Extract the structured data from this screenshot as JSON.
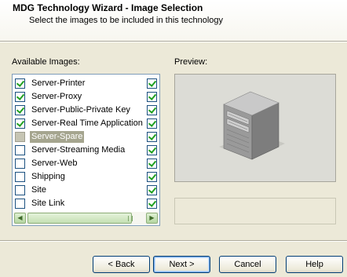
{
  "header": {
    "title": "MDG Technology Wizard - Image Selection",
    "subtitle": "Select the images to be included in this technology"
  },
  "available": {
    "label": "Available Images:",
    "items": [
      {
        "label": "Server-Printer",
        "left_checked": true,
        "right_checked": true
      },
      {
        "label": "Server-Proxy",
        "left_checked": true,
        "right_checked": true
      },
      {
        "label": "Server-Public-Private Key",
        "left_checked": true,
        "right_checked": true
      },
      {
        "label": "Server-Real Time Application",
        "left_checked": true,
        "right_checked": true
      },
      {
        "label": "Server-Spare",
        "left_checked": false,
        "right_checked": true,
        "selected": true
      },
      {
        "label": "Server-Streaming Media",
        "left_checked": false,
        "right_checked": true
      },
      {
        "label": "Server-Web",
        "left_checked": false,
        "right_checked": true
      },
      {
        "label": "Shipping",
        "left_checked": false,
        "right_checked": true
      },
      {
        "label": "Site",
        "left_checked": false,
        "right_checked": true
      },
      {
        "label": "Site Link",
        "left_checked": false,
        "right_checked": true
      }
    ]
  },
  "preview": {
    "label": "Preview:",
    "caption": ""
  },
  "buttons": {
    "back": "< Back",
    "next": "Next >",
    "cancel": "Cancel",
    "help": "Help"
  }
}
